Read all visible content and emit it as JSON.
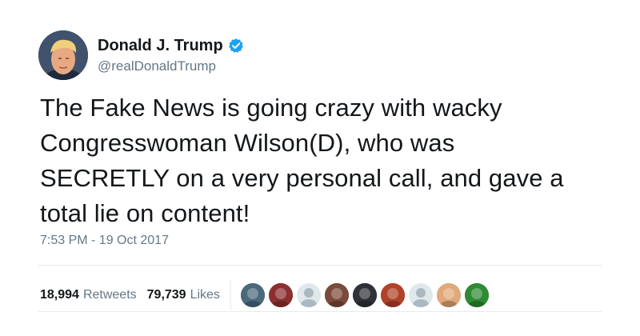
{
  "user": {
    "display_name": "Donald J. Trump",
    "handle": "@realDonaldTrump",
    "verified": true
  },
  "tweet": {
    "text_lines": [
      "The Fake News is going crazy with wacky",
      "Congresswoman Wilson(D), who was",
      "SECRETLY on a very personal call, and gave a",
      "total lie on content!"
    ],
    "timestamp": "7:53 PM - 19 Oct 2017"
  },
  "stats": {
    "retweets_count": "18,994",
    "retweets_label": "Retweets",
    "likes_count": "79,739",
    "likes_label": "Likes"
  },
  "likers": [
    {
      "kind": "photo",
      "color": "#4a6a7c"
    },
    {
      "kind": "photo",
      "color": "#8c2f2f"
    },
    {
      "kind": "default",
      "color": "#aab8c2"
    },
    {
      "kind": "photo",
      "color": "#7a4b3a"
    },
    {
      "kind": "photo",
      "color": "#2e3138"
    },
    {
      "kind": "photo",
      "color": "#b0422a"
    },
    {
      "kind": "default",
      "color": "#aab8c2"
    },
    {
      "kind": "photo",
      "color": "#e0a97a"
    },
    {
      "kind": "photo",
      "color": "#2f8a34"
    }
  ],
  "colors": {
    "verified_badge": "#1da1f2",
    "secondary_text": "#657786",
    "divider": "#e6ecf0"
  }
}
